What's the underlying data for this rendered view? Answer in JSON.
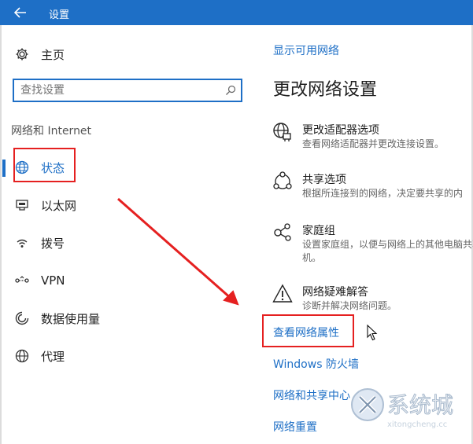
{
  "window": {
    "title": "设置"
  },
  "nav": {
    "home_label": "主页",
    "search_placeholder": "查找设置",
    "section_title": "网络和 Internet",
    "items": [
      {
        "label": "状态",
        "icon": "globe-icon",
        "selected": true
      },
      {
        "label": "以太网",
        "icon": "ethernet-icon"
      },
      {
        "label": "拨号",
        "icon": "dialup-icon"
      },
      {
        "label": "VPN",
        "icon": "vpn-icon"
      },
      {
        "label": "数据使用量",
        "icon": "data-usage-icon"
      },
      {
        "label": "代理",
        "icon": "proxy-globe-icon"
      }
    ]
  },
  "main": {
    "top_link": "显示可用网络",
    "heading": "更改网络设置",
    "options": [
      {
        "title": "更改适配器选项",
        "desc": "查看网络适配器并更改连接设置。",
        "icon": "adapter-icon"
      },
      {
        "title": "共享选项",
        "desc": "根据所连接到的网络，决定要共享的内",
        "icon": "share-icon"
      },
      {
        "title": "家庭组",
        "desc": "设置家庭组，以便与网络上的其他电脑共享图片、音乐、文件和打印机。",
        "desc_visible": "设置家庭组，以便与网络上的其他电脑",
        "desc_line2": "机。",
        "icon": "homegroup-icon"
      },
      {
        "title": "网络疑难解答",
        "desc": "诊断并解决网络问题。",
        "icon": "warning-icon"
      }
    ],
    "links": [
      "查看网络属性",
      "Windows 防火墙",
      "网络和共享中心",
      "网络重置"
    ]
  },
  "watermark": {
    "brand": "系统城",
    "domain": "xitongcheng.cc"
  },
  "colors": {
    "accent": "#1e6fc6",
    "highlight_box": "#e52020",
    "arrow": "#e52020"
  }
}
